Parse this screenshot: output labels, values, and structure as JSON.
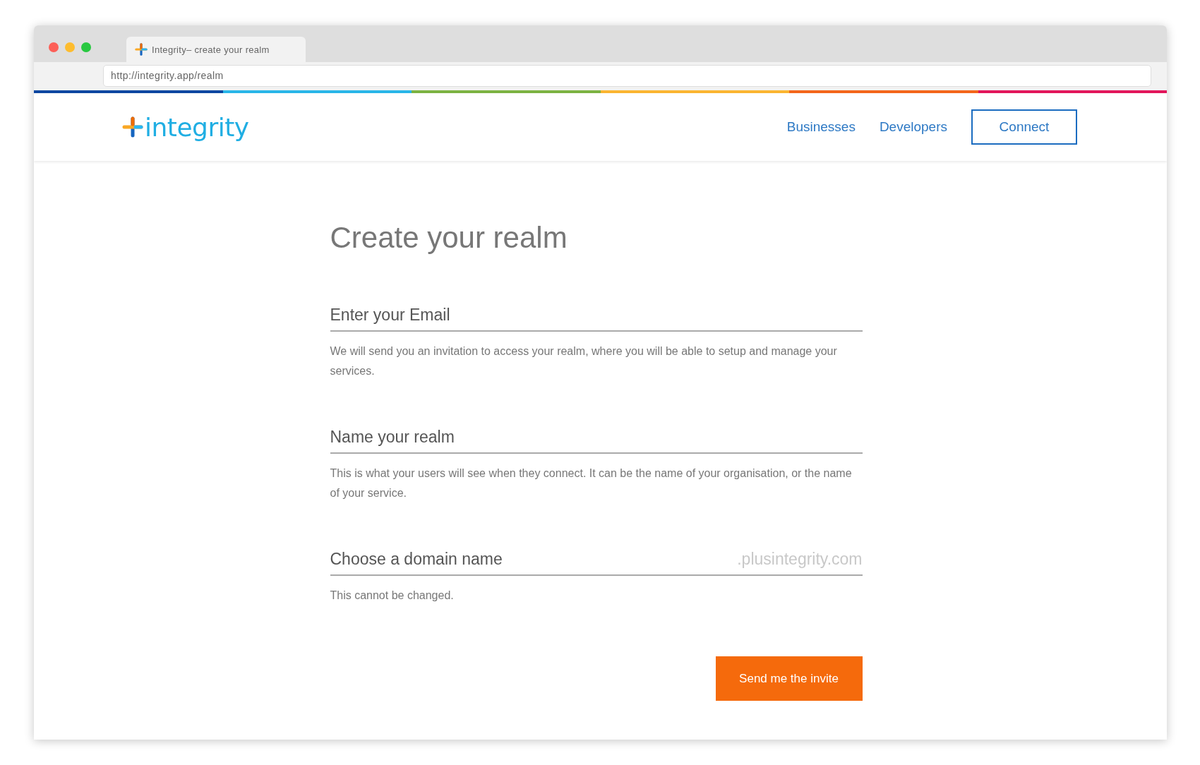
{
  "browser": {
    "tab_title": "Integrity– create your realm",
    "url": "http://integrity.app/realm"
  },
  "header": {
    "logo": "integrity",
    "nav": [
      "Businesses",
      "Developers"
    ],
    "connect": "Connect"
  },
  "title": "Create your realm",
  "fields": [
    {
      "placeholder": "Enter your Email",
      "help": "We will send you an invitation to access your realm, where you will be able to setup and manage your services."
    },
    {
      "placeholder": "Name your realm",
      "help": "This is what your users will see when they connect. It can be the name of your organisation, or the name of your service."
    },
    {
      "placeholder": "Choose a domain name",
      "suffix": ".plusintegrity.com",
      "help": "This cannot be changed."
    }
  ],
  "submit": "Send me the invite"
}
